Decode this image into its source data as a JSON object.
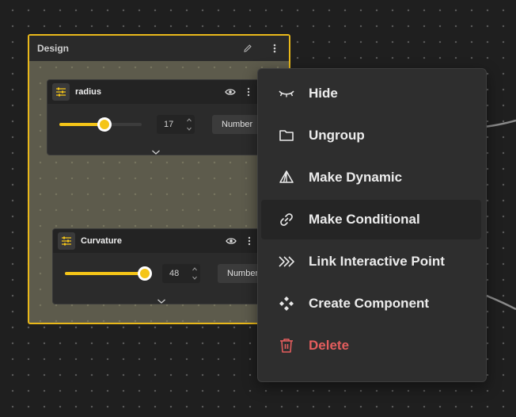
{
  "group": {
    "title": "Design",
    "params": [
      {
        "label": "radius",
        "value": "17",
        "slider_level": 0.55,
        "type": "Number"
      },
      {
        "label": "Curvature",
        "value": "48",
        "slider_level": 0.97,
        "type": "Number"
      }
    ]
  },
  "menu": {
    "items": [
      {
        "label": "Hide",
        "icon": "eye-closed-icon"
      },
      {
        "label": "Ungroup",
        "icon": "folder-icon"
      },
      {
        "label": "Make Dynamic",
        "icon": "pyramid-icon"
      },
      {
        "label": "Make Conditional",
        "icon": "link-icon",
        "hovered": true
      },
      {
        "label": "Link Interactive Point",
        "icon": "double-chevron-icon"
      },
      {
        "label": "Create Component",
        "icon": "component-icon"
      },
      {
        "label": "Delete",
        "icon": "trash-icon",
        "color": "#e35d5d"
      }
    ]
  },
  "colors": {
    "accent": "#f5c518",
    "group_border": "#e9b81a",
    "danger": "#e35d5d"
  }
}
